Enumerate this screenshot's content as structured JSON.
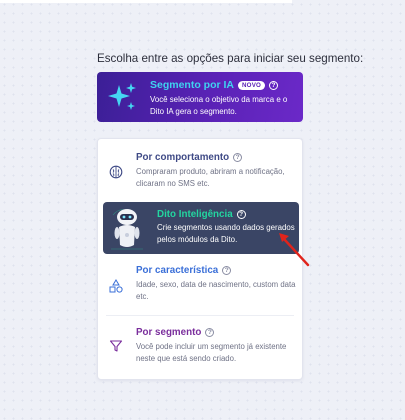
{
  "intro": {
    "text": "Escolha entre as opções para iniciar seu segmento:"
  },
  "ia_card": {
    "title": "Segmento por IA",
    "badge": "NOVO",
    "help": "?",
    "description": "Você seleciona o objetivo da marca e o Dito IA gera o segmento.",
    "icon": "sparkles-icon",
    "colors": {
      "gradient_start": "#3b1f96",
      "gradient_end": "#6b29c8",
      "title": "#3fd3f0"
    }
  },
  "options": [
    {
      "id": "comportamento",
      "title": "Por comportamento",
      "help": "?",
      "description": "Compraram produto, abriram a notificação, clicaram no SMS etc.",
      "icon": "brain-icon",
      "color": "#3f4a86"
    },
    {
      "id": "caracteristica",
      "title": "Por característica",
      "help": "?",
      "description": "Idade, sexo, data de nascimento, custom data etc.",
      "icon": "shapes-icon",
      "color": "#3a6fd8"
    },
    {
      "id": "segmento",
      "title": "Por segmento",
      "help": "?",
      "description": "Você pode incluir um segmento já existente neste que está sendo criado.",
      "icon": "funnel-icon",
      "color": "#7a2e9c"
    }
  ],
  "dito_tooltip": {
    "title": "Dito Inteligência",
    "help": "?",
    "description": "Crie segmentos usando dados gerados pelos módulos da Dito.",
    "icon": "robot-icon",
    "colors": {
      "background": "#3a4565",
      "title": "#23d6a0"
    }
  },
  "annotation": {
    "icon": "red-arrow-icon",
    "color": "#e0241c"
  }
}
